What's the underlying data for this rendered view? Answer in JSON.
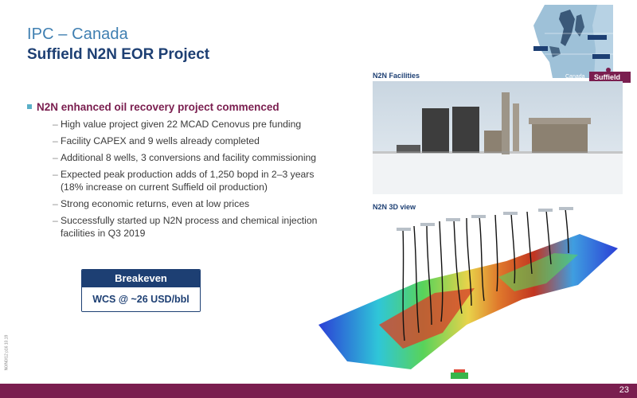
{
  "title": {
    "main": "IPC – Canada",
    "sub": "Suffield N2N EOR Project"
  },
  "heading": "N2N enhanced oil recovery project commenced",
  "bullets": [
    "High value project given 22 MCAD Cenovus pre funding",
    "Facility CAPEX and 9 wells already completed",
    "Additional 8 wells, 3 conversions and facility commissioning",
    "Expected peak production adds of 1,250 bopd in 2–3 years (18% increase on current Suffield oil production)",
    "Strong economic returns, even at low prices",
    "Successfully started up N2N process and chemical injection facilities in Q3 2019"
  ],
  "breakeven": {
    "label": "Breakeven",
    "value": "WCS @ ~26 USD/bbl"
  },
  "images": {
    "facilities_label": "N2N Facilities",
    "view_label": "N2N 3D view"
  },
  "map": {
    "suffield_label": "Suffield",
    "canada_label": "Canada"
  },
  "footer": {
    "page_number": "23"
  },
  "side_code": "N0/N0/12 p16 10.19",
  "colors": {
    "title_blue": "#3f7fb1",
    "navy": "#1d3f73",
    "maroon": "#7a1e4f",
    "bullet_square": "#5ab0c8"
  }
}
